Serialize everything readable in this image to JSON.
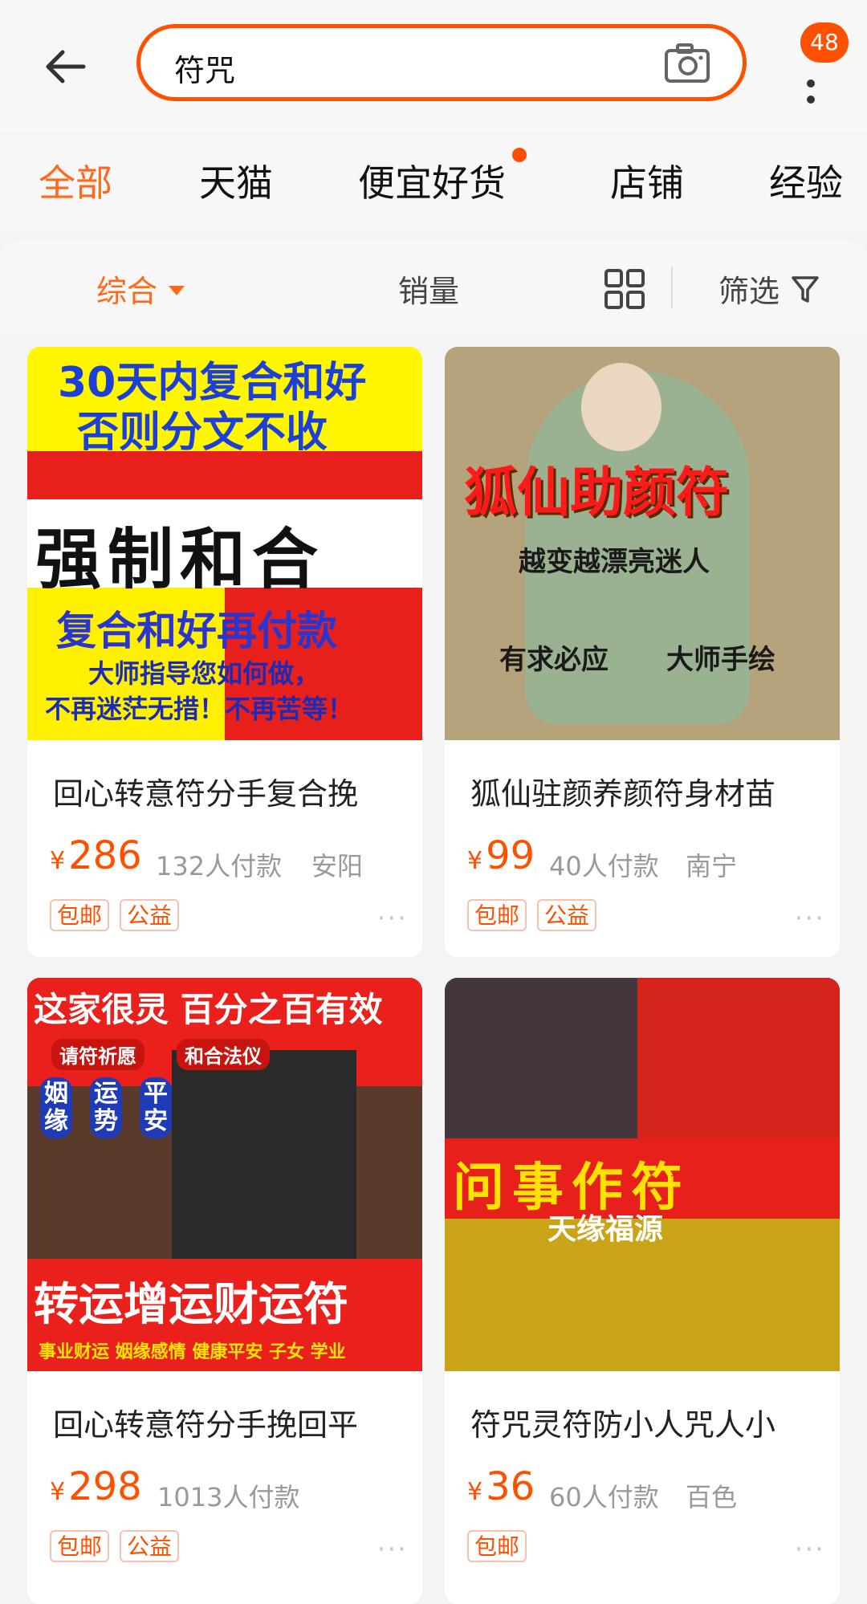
{
  "search": {
    "query": "符咒",
    "badge": "48"
  },
  "tabs": [
    "全部",
    "天猫",
    "便宜好货",
    "店铺",
    "经验"
  ],
  "sort": {
    "comprehensive": "综合",
    "sales": "销量",
    "filter": "筛选"
  },
  "colors": {
    "accent": "#ff5000",
    "tab_active": "#ff6a1a"
  },
  "products": [
    {
      "title": "回心转意符分手复合挽",
      "price_symbol": "¥",
      "price": "286",
      "sold": "132人付款",
      "location": "安阳",
      "tags": [
        "包邮",
        "公益"
      ],
      "banner": [
        "30天内复合和好",
        "否则分文不收",
        "强制和合",
        "复合和好再付款",
        "大师指导您如何做，",
        "不再迷茫无措！不再苦等！"
      ]
    },
    {
      "title": "狐仙驻颜养颜符身材苗",
      "price_symbol": "¥",
      "price": "99",
      "sold": "40人付款",
      "location": "南宁",
      "tags": [
        "包邮",
        "公益"
      ],
      "banner": [
        "狐仙助颜符",
        "越变越漂亮迷人",
        "有求必应",
        "大师手绘"
      ]
    },
    {
      "title": "回心转意符分手挽回平",
      "price_symbol": "¥",
      "price": "298",
      "sold": "1013人付款",
      "location": "",
      "tags": [
        "包邮",
        "公益"
      ],
      "banner": [
        "这家很灵 百分之百有效",
        "请符祈愿",
        "和合法仪",
        "姻缘",
        "运势",
        "平安",
        "转运增运财运符",
        "事业财运 姻缘感情 健康平安 子女 学业"
      ]
    },
    {
      "title": "符咒灵符防小人咒人小",
      "price_symbol": "¥",
      "price": "36",
      "sold": "60人付款",
      "location": "百色",
      "tags": [
        "包邮"
      ],
      "banner": [
        "问事作符",
        "天缘福源"
      ]
    }
  ]
}
